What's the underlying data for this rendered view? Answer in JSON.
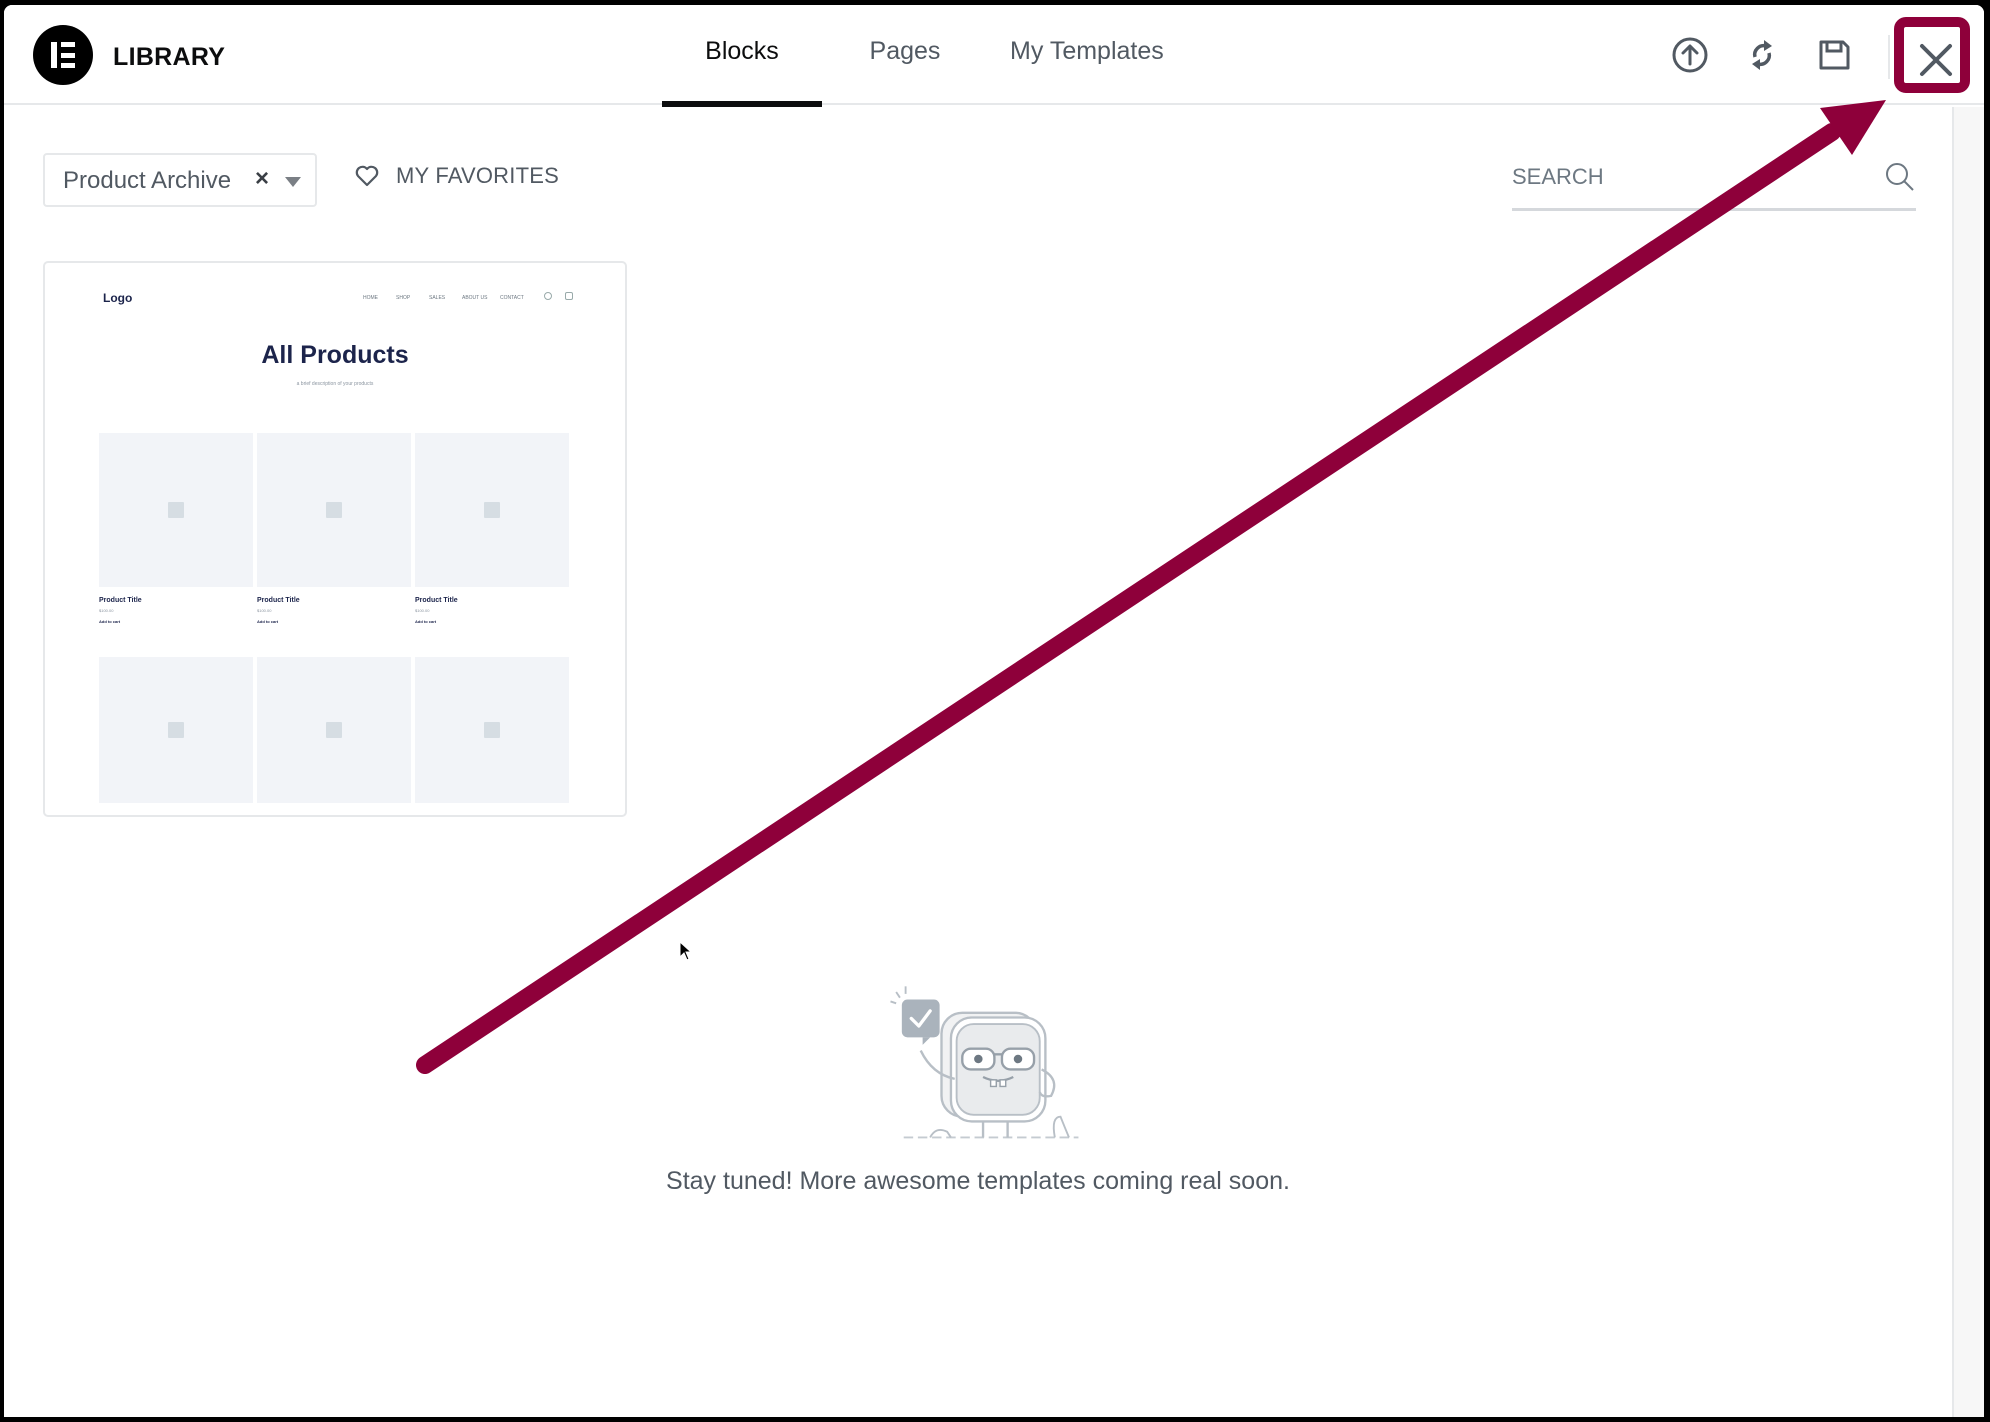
{
  "header": {
    "logo_icon": "elementor-logo-icon",
    "title": "LIBRARY",
    "tabs": [
      {
        "label": "Blocks",
        "active": true
      },
      {
        "label": "Pages",
        "active": false
      },
      {
        "label": "My Templates",
        "active": false
      }
    ],
    "actions": [
      {
        "name": "import-icon",
        "label": "Import Template"
      },
      {
        "name": "sync-icon",
        "label": "Sync Library"
      },
      {
        "name": "save-icon",
        "label": "Save as Template"
      }
    ],
    "close_icon": "close-icon"
  },
  "toolbar": {
    "category_filter": {
      "value": "Product Archive",
      "clear_glyph": "×"
    },
    "favorites_label": "MY FAVORITES",
    "search_placeholder": "SEARCH"
  },
  "template_card": {
    "preview": {
      "logo": "Logo",
      "nav": [
        "HOME",
        "SHOP",
        "SALES",
        "ABOUT US",
        "CONTACT"
      ],
      "heading": "All Products",
      "subheading": "a brief description of your products",
      "products": [
        {
          "title": "Product Title",
          "price": "$100.00",
          "cta": "Add to cart"
        },
        {
          "title": "Product Title",
          "price": "$100.00",
          "cta": "Add to cart"
        },
        {
          "title": "Product Title",
          "price": "$100.00",
          "cta": "Add to cart"
        }
      ]
    }
  },
  "empty_state": {
    "illustration": "mascot-waving-illustration",
    "message": "Stay tuned! More awesome templates coming real soon."
  },
  "annotation": {
    "color": "#8e003a",
    "target": "close-button"
  }
}
